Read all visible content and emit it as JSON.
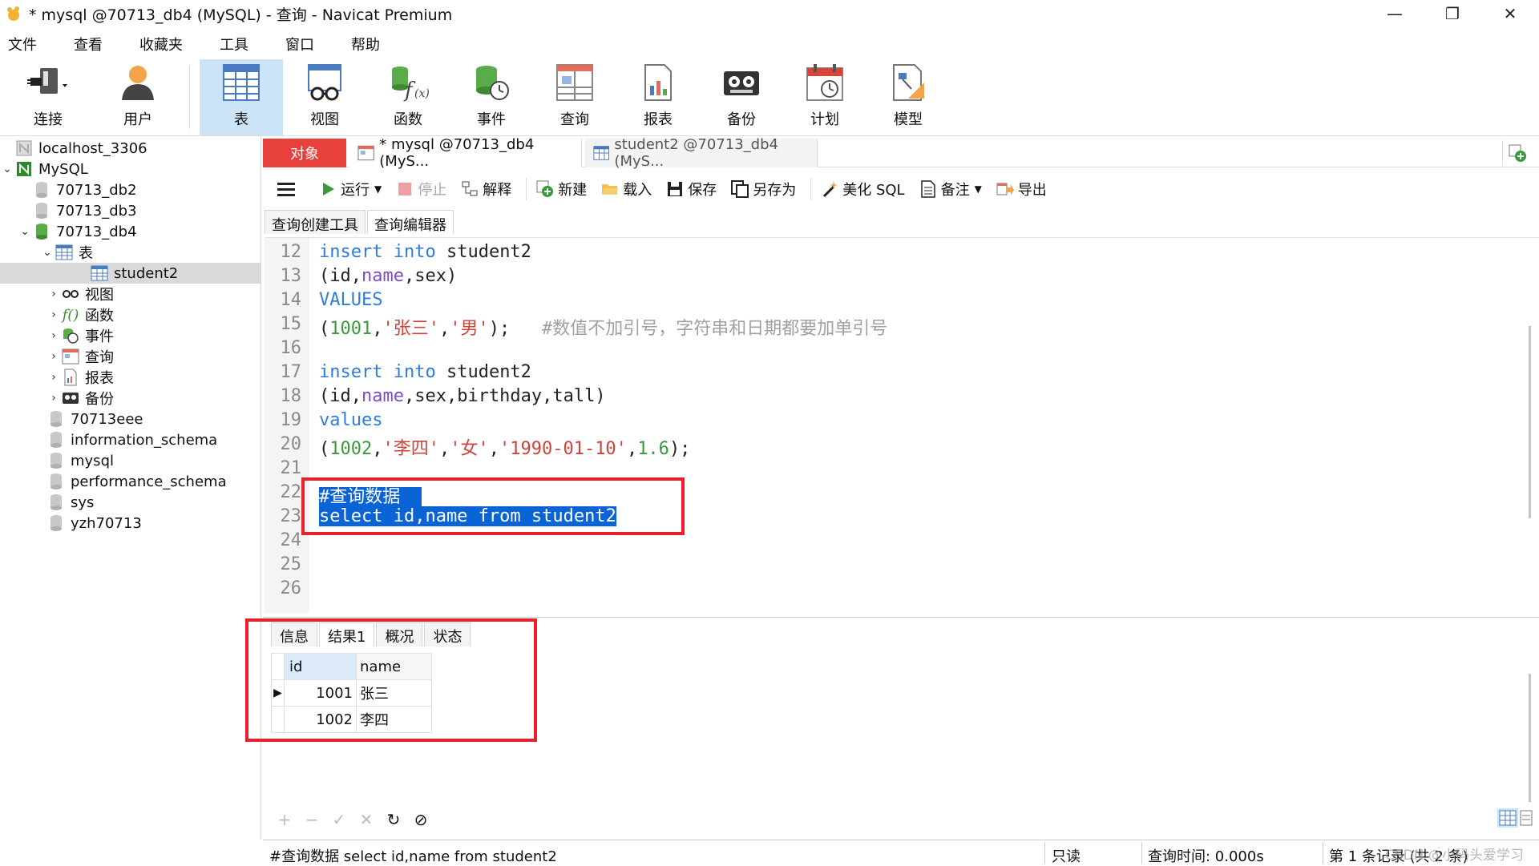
{
  "window": {
    "title": "* mysql @70713_db4 (MySQL) - 查询 - Navicat Premium",
    "controls": {
      "minimize": "—",
      "maximize": "❐",
      "close": "✕"
    }
  },
  "menu": [
    "文件",
    "查看",
    "收藏夹",
    "工具",
    "窗口",
    "帮助"
  ],
  "toolbar": {
    "connect": "连接",
    "user": "用户",
    "table": "表",
    "view": "视图",
    "function": "函数",
    "event": "事件",
    "query": "查询",
    "report": "报表",
    "backup": "备份",
    "schedule": "计划",
    "model": "模型"
  },
  "navigator": {
    "items": [
      {
        "label": "localhost_3306"
      },
      {
        "label": "MySQL"
      },
      {
        "label": "70713_db2"
      },
      {
        "label": "70713_db3"
      },
      {
        "label": "70713_db4"
      },
      {
        "label": "表"
      },
      {
        "label": "student2"
      },
      {
        "label": "视图"
      },
      {
        "label": "函数"
      },
      {
        "label": "事件"
      },
      {
        "label": "查询"
      },
      {
        "label": "报表"
      },
      {
        "label": "备份"
      },
      {
        "label": "70713eee"
      },
      {
        "label": "information_schema"
      },
      {
        "label": "mysql"
      },
      {
        "label": "performance_schema"
      },
      {
        "label": "sys"
      },
      {
        "label": "yzh70713"
      }
    ]
  },
  "tabs": {
    "objects": "对象",
    "query_tab": "* mysql @70713_db4 (MyS...",
    "table_tab": "student2 @70713_db4 (MyS..."
  },
  "query_toolbar": {
    "run": "运行",
    "stop": "停止",
    "explain": "解释",
    "new": "新建",
    "load": "载入",
    "save": "保存",
    "save_as": "另存为",
    "beautify": "美化 SQL",
    "comment": "备注",
    "export": "导出"
  },
  "subtabs": {
    "builder": "查询创建工具",
    "editor": "查询编辑器"
  },
  "editor": {
    "line_numbers": [
      "12",
      "13",
      "14",
      "15",
      "16",
      "17",
      "18",
      "19",
      "20",
      "21",
      "22",
      "23",
      "24",
      "25",
      "26"
    ],
    "l12": {
      "kw1": "insert",
      "kw2": "into",
      "rest": " student2"
    },
    "l13": {
      "a": "(id,",
      "b": "name",
      "c": ",sex)"
    },
    "l14": {
      "kw": "VALUES"
    },
    "l15": {
      "a": "(",
      "num": "1001",
      "b": ",",
      "s1": "'张三'",
      "c": ",",
      "s2": "'男'",
      "d": ");",
      "comment": "#数值不加引号，字符串和日期都要加单引号"
    },
    "l17": {
      "kw1": "insert",
      "kw2": "into",
      "rest": " student2"
    },
    "l18": {
      "a": "(id,",
      "b": "name",
      "c": ",sex,birthday,tall)"
    },
    "l19": {
      "kw": "values"
    },
    "l20": {
      "a": "(",
      "num1": "1002",
      "b": ",",
      "s1": "'李四'",
      "c": ",",
      "s2": "'女'",
      "d": ",",
      "s3": "'1990-01-10'",
      "e": ",",
      "num2": "1.6",
      "f": ");"
    },
    "l22": "#查询数据",
    "l23": "select id,name from student2"
  },
  "result": {
    "tabs": [
      "信息",
      "结果1",
      "概况",
      "状态"
    ],
    "columns": [
      "id",
      "name"
    ],
    "rows": [
      {
        "id": "1001",
        "name": "张三"
      },
      {
        "id": "1002",
        "name": "李四"
      }
    ],
    "nav_buttons": [
      "+",
      "−",
      "✓",
      "✕",
      "↻",
      "⊘"
    ]
  },
  "status": {
    "query": "#查询数据 select id,name from student2",
    "readonly": "只读",
    "time": "查询时间: 0.000s",
    "records": "第 1 条记录 (共 2 条)",
    "watermark": "CSDN @小码头爱学习"
  },
  "colors": {
    "accent": "#2d7de0",
    "objects_tab": "#e8413b",
    "highlight": "#0a64d6",
    "annotation": "#e8202a"
  }
}
